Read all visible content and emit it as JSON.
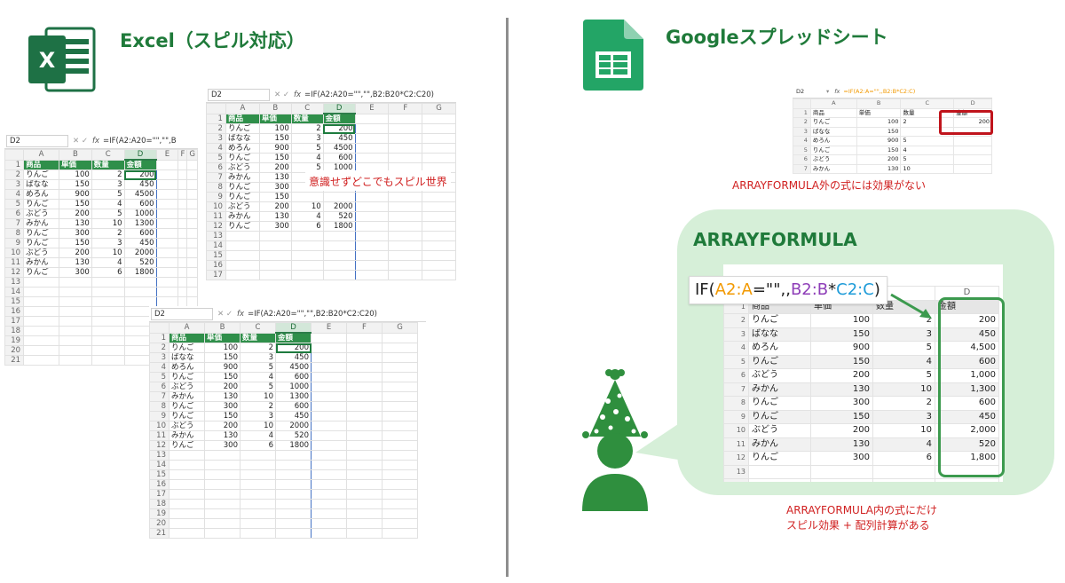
{
  "left": {
    "title": "Excel（スピル対応）",
    "logo_letter": "X",
    "note": "意識せずどこでもスピル世界"
  },
  "right": {
    "title": "Googleスプレッドシート",
    "note_small": "ARRAYFORMULA外の式には効果がない",
    "bubble_title": "ARRAYFORMULA",
    "note_bottom_1": "ARRAYFORMULA内の式にだけ",
    "note_bottom_2": "スピル効果 + 配列計算がある",
    "formula_parts": {
      "p1": "IF(",
      "p2": "A2:A",
      "p3": "=\"\",,",
      "p4": "B2:B",
      "p5": "*",
      "p6": "C2:C",
      "p7": ")"
    }
  },
  "excel": {
    "cell_ref": "D2",
    "formula": "=IF(A2:A20=\"\",\"\",B2:B20*C2:C20)",
    "formula_short": "=IF(A2:A20=\"\",\"\",B",
    "cols": [
      "A",
      "B",
      "C",
      "D",
      "E",
      "F",
      "G"
    ],
    "headers": [
      "商品",
      "単価",
      "数量",
      "金額"
    ],
    "rows": [
      [
        "りんご",
        "100",
        "2",
        "200"
      ],
      [
        "ばなな",
        "150",
        "3",
        "450"
      ],
      [
        "めろん",
        "900",
        "5",
        "4500"
      ],
      [
        "りんご",
        "150",
        "4",
        "600"
      ],
      [
        "ぶどう",
        "200",
        "5",
        "1000"
      ],
      [
        "みかん",
        "130",
        "10",
        "1300"
      ],
      [
        "りんご",
        "300",
        "2",
        "600"
      ],
      [
        "りんご",
        "150",
        "3",
        "450"
      ],
      [
        "ぶどう",
        "200",
        "10",
        "2000"
      ],
      [
        "みかん",
        "130",
        "4",
        "520"
      ],
      [
        "りんご",
        "300",
        "6",
        "1800"
      ]
    ],
    "mid_rows": [
      [
        "りんご",
        "100",
        "2",
        "200"
      ],
      [
        "ばなな",
        "150",
        "3",
        "450"
      ],
      [
        "めろん",
        "900",
        "5",
        "4500"
      ],
      [
        "りんご",
        "150",
        "4",
        "600"
      ],
      [
        "ぶどう",
        "200",
        "5",
        "1000"
      ],
      [
        "みかん",
        "130",
        "",
        ""
      ],
      [
        "りんご",
        "300",
        "",
        ""
      ],
      [
        "りんご",
        "150",
        "",
        ""
      ],
      [
        "ぶどう",
        "200",
        "10",
        "2000"
      ],
      [
        "みかん",
        "130",
        "4",
        "520"
      ],
      [
        "りんご",
        "300",
        "6",
        "1800"
      ]
    ]
  },
  "gsheet_small": {
    "cell_ref": "D2",
    "formula": "=IF(A2:A=\"\",,B2:B*C2:C)",
    "cols": [
      "A",
      "B",
      "C",
      "D"
    ],
    "headers": [
      "商品",
      "単価",
      "数量",
      "金額"
    ],
    "rows": [
      [
        "りんご",
        "100",
        "2",
        "200"
      ],
      [
        "ばなな",
        "150",
        "",
        ""
      ],
      [
        "めろん",
        "900",
        "5",
        ""
      ],
      [
        "りんご",
        "150",
        "4",
        ""
      ],
      [
        "ぶどう",
        "200",
        "5",
        ""
      ],
      [
        "みかん",
        "130",
        "10",
        ""
      ]
    ]
  },
  "gsheet_big": {
    "col_d": "D",
    "headers": [
      "商品",
      "単価",
      "数量",
      "金額"
    ],
    "rows": [
      [
        "りんご",
        "100",
        "2",
        "200"
      ],
      [
        "ばなな",
        "150",
        "3",
        "450"
      ],
      [
        "めろん",
        "900",
        "5",
        "4,500"
      ],
      [
        "りんご",
        "150",
        "4",
        "600"
      ],
      [
        "ぶどう",
        "200",
        "5",
        "1,000"
      ],
      [
        "みかん",
        "130",
        "10",
        "1,300"
      ],
      [
        "りんご",
        "300",
        "2",
        "600"
      ],
      [
        "りんご",
        "150",
        "3",
        "450"
      ],
      [
        "ぶどう",
        "200",
        "10",
        "2,000"
      ],
      [
        "みかん",
        "130",
        "4",
        "520"
      ],
      [
        "りんご",
        "300",
        "6",
        "1,800"
      ]
    ]
  },
  "colors": {
    "brand_green": "#1f7a3a",
    "sheets_green": "#23a566",
    "highlight_red": "#c0141c",
    "formula_orange": "#f29900",
    "formula_purple": "#8e3eb8",
    "formula_blue": "#1e9bd8"
  }
}
